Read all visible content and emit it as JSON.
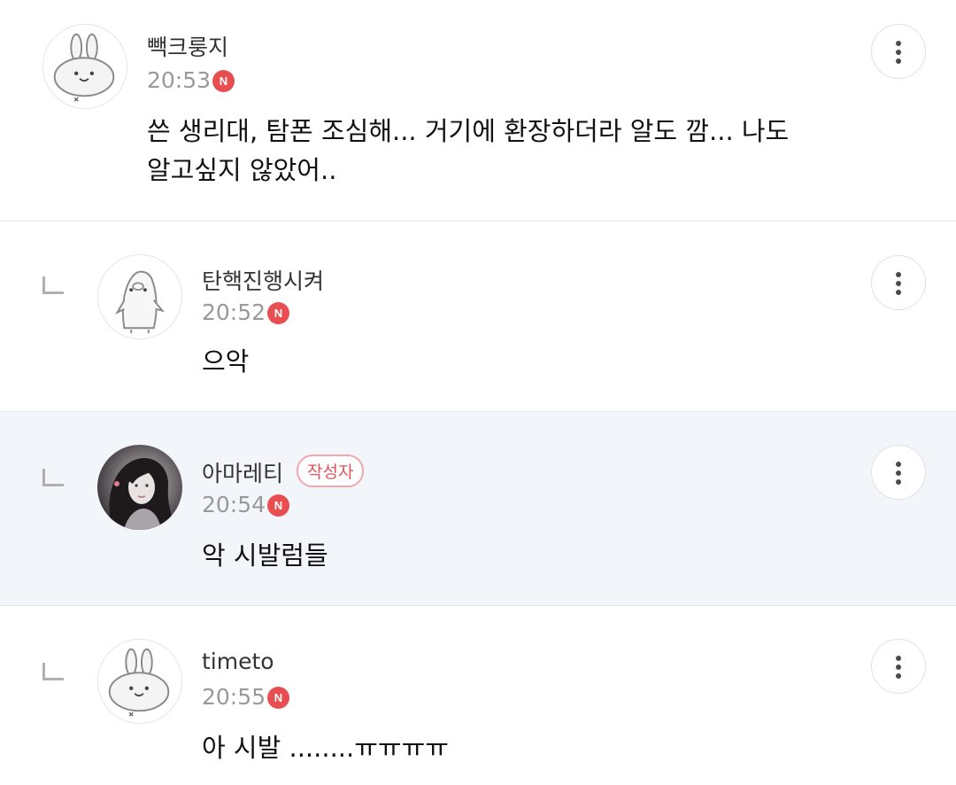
{
  "comments": [
    {
      "nickname": "빽크룽지",
      "time": "20:53",
      "new_badge": "N",
      "text_lines": [
        "쓴 생리대, 탐폰 조심해... 거기에 환장하더라 알도 깜... 나도",
        "알고싶지 않았어.."
      ],
      "avatar": "default-rabbit-avatar"
    },
    {
      "nickname": "탄핵진행시켜",
      "time": "20:52",
      "new_badge": "N",
      "text": "으악",
      "avatar": "default-penguin-avatar"
    },
    {
      "nickname": "아마레티",
      "author_badge": "작성자",
      "time": "20:54",
      "new_badge": "N",
      "text": "악 시발럼들",
      "avatar": "profile-photo-avatar",
      "highlight_color": "#f2f6fa"
    },
    {
      "nickname": "timeto",
      "time": "20:55",
      "new_badge": "N",
      "text": "아 시발 ........ㅠㅠㅠㅠ",
      "avatar": "default-rabbit-avatar"
    }
  ],
  "icons": {
    "more": "vertical-ellipsis-icon",
    "reply": "reply-indent-icon",
    "new": "new-badge-icon"
  },
  "colors": {
    "new_badge": "#e84e4f",
    "author_badge": "#e0565a",
    "time": "#999999"
  }
}
